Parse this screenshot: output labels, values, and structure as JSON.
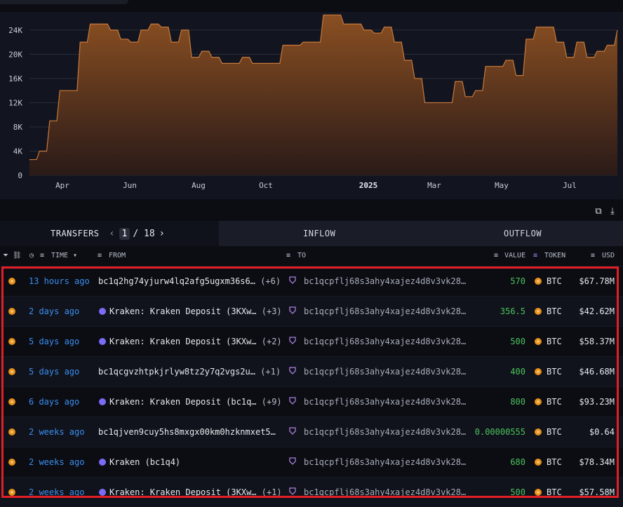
{
  "chart": {
    "y_ticks": [
      "24K",
      "20K",
      "16K",
      "12K",
      "8K",
      "4K",
      "0"
    ],
    "x_ticks": [
      "Apr",
      "Jun",
      "Aug",
      "Oct",
      "2025",
      "Mar",
      "May",
      "Jul"
    ],
    "colors": {
      "fill_top": "#8a4f22",
      "fill_bottom": "#2a1a18",
      "line": "#c97a3a",
      "grid": "#2a2d38"
    }
  },
  "chart_data": {
    "type": "area",
    "title": "",
    "xlabel": "",
    "ylabel": "",
    "ylim": [
      0,
      27000
    ],
    "x_ticks": [
      "Apr",
      "Jun",
      "Aug",
      "Oct",
      "2025",
      "Mar",
      "May",
      "Jul"
    ],
    "series": [
      {
        "values": [
          2600,
          4000,
          9000,
          14000,
          14000,
          22000,
          25000,
          25000,
          24000,
          22500,
          22000,
          24000,
          25000,
          24500,
          22000,
          24000,
          19500,
          20500,
          19500,
          18500,
          18500,
          19500,
          18500,
          18500,
          18500,
          21500,
          21500,
          22000,
          22000,
          26500,
          26500,
          25000,
          25000,
          24000,
          23500,
          24500,
          22000,
          19000,
          16000,
          12000,
          12000,
          12000,
          15500,
          13000,
          14000,
          18000,
          18000,
          19000,
          16500,
          22500,
          24500,
          24500,
          22000,
          19500,
          22000,
          19500,
          20500,
          21500,
          24000
        ]
      }
    ]
  },
  "toolbar": {
    "copy_icon": "copy-icon",
    "download_icon": "download-icon"
  },
  "tabs": {
    "transfers": "TRANSFERS",
    "page_current": "1",
    "page_sep": "/ 18",
    "inflow": "INFLOW",
    "outflow": "OUTFLOW"
  },
  "columns": {
    "time": "TIME",
    "from": "FROM",
    "to": "TO",
    "value": "VALUE",
    "token": "TOKEN",
    "usd": "USD"
  },
  "rows": [
    {
      "time": "13 hours ago",
      "kraken": false,
      "from": "bc1q2hg74yjurw4lq2afg5ugxm36s6…",
      "more": "(+6)",
      "to": "bc1qcpflj68s3ahy4xajez4d8v3vk28…",
      "value": "570",
      "token": "BTC",
      "usd": "$67.78M"
    },
    {
      "time": "2 days ago",
      "kraken": true,
      "from": "Kraken: Kraken Deposit (3KXw…",
      "more": "(+3)",
      "to": "bc1qcpflj68s3ahy4xajez4d8v3vk28…",
      "value": "356.5",
      "token": "BTC",
      "usd": "$42.62M"
    },
    {
      "time": "5 days ago",
      "kraken": true,
      "from": "Kraken: Kraken Deposit (3KXw…",
      "more": "(+2)",
      "to": "bc1qcpflj68s3ahy4xajez4d8v3vk28…",
      "value": "500",
      "token": "BTC",
      "usd": "$58.37M"
    },
    {
      "time": "5 days ago",
      "kraken": false,
      "from": "bc1qcgvzhtpkjrlyw8tz2y7q2vgs2u…",
      "more": "(+1)",
      "to": "bc1qcpflj68s3ahy4xajez4d8v3vk28…",
      "value": "400",
      "token": "BTC",
      "usd": "$46.68M"
    },
    {
      "time": "6 days ago",
      "kraken": true,
      "from": "Kraken: Kraken Deposit (bc1q…",
      "more": "(+9)",
      "to": "bc1qcpflj68s3ahy4xajez4d8v3vk28…",
      "value": "800",
      "token": "BTC",
      "usd": "$93.23M"
    },
    {
      "time": "2 weeks ago",
      "kraken": false,
      "from": "bc1qjven9cuy5hs8mxgx00km0hzknmxet5…",
      "more": "",
      "to": "bc1qcpflj68s3ahy4xajez4d8v3vk28…",
      "value": "0.00000555",
      "token": "BTC",
      "usd": "$0.64"
    },
    {
      "time": "2 weeks ago",
      "kraken": true,
      "from": "Kraken (bc1q4)",
      "more": "",
      "to": "bc1qcpflj68s3ahy4xajez4d8v3vk28…",
      "value": "680",
      "token": "BTC",
      "usd": "$78.34M"
    },
    {
      "time": "2 weeks ago",
      "kraken": true,
      "from": "Kraken: Kraken Deposit (3KXw…",
      "more": "(+1)",
      "to": "bc1qcpflj68s3ahy4xajez4d8v3vk28…",
      "value": "500",
      "token": "BTC",
      "usd": "$57.58M"
    }
  ]
}
